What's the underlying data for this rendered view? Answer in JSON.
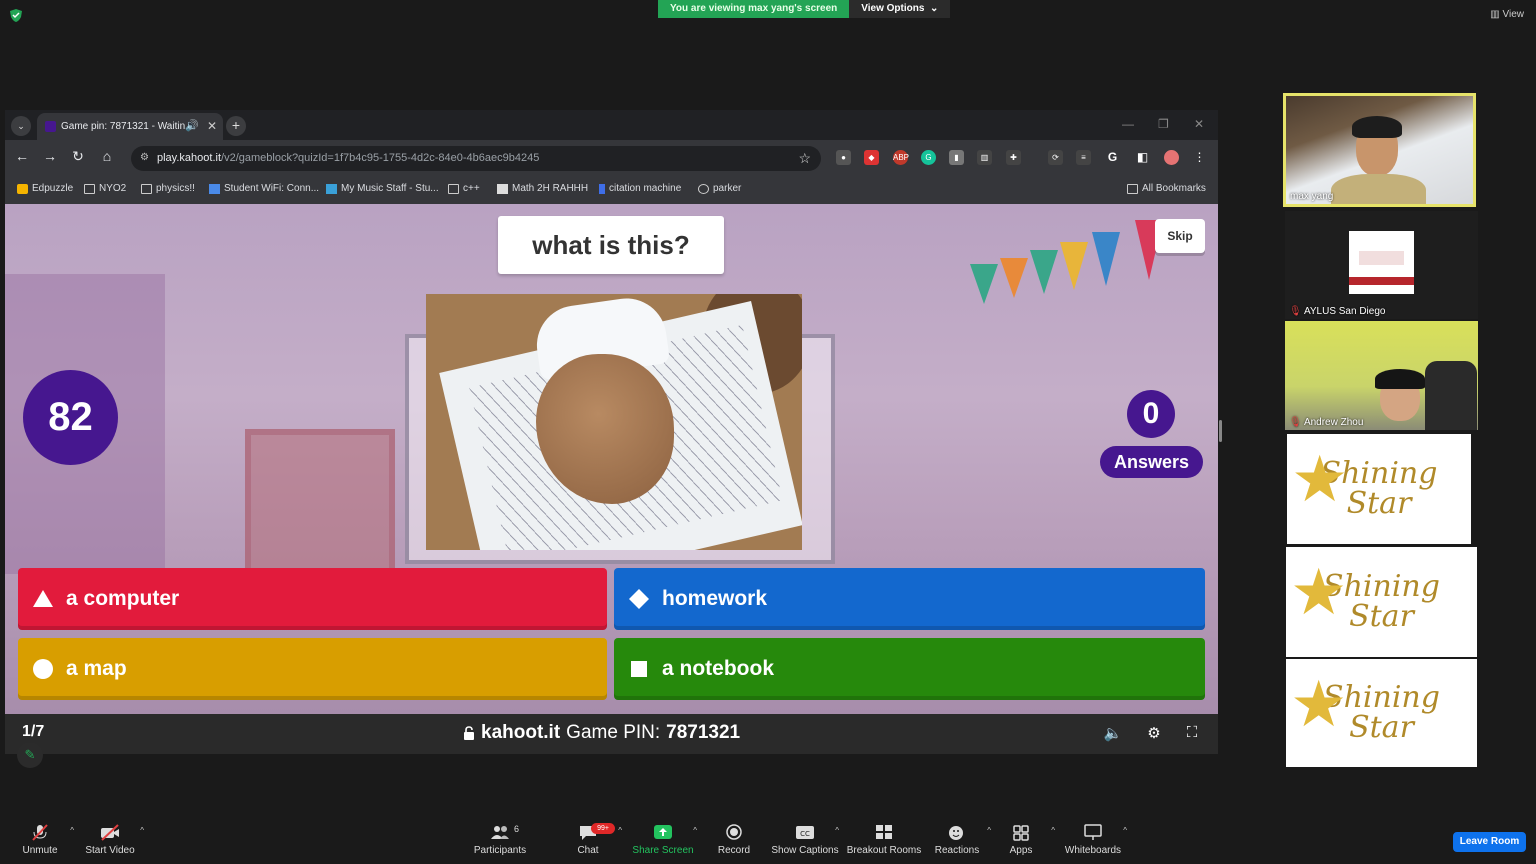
{
  "zoom": {
    "share_banner": "You are viewing max yang's screen",
    "view_options": "View Options",
    "view_label": "View",
    "leave": "Leave Room",
    "toolbar": [
      {
        "id": "unmute",
        "label": "Unmute",
        "icon": "muted-mic-icon"
      },
      {
        "id": "video",
        "label": "Start Video",
        "icon": "video-off-icon"
      },
      {
        "id": "participants",
        "label": "Participants",
        "count": "6",
        "icon": "participants-icon"
      },
      {
        "id": "chat",
        "label": "Chat",
        "badge": "99+",
        "icon": "chat-icon"
      },
      {
        "id": "share",
        "label": "Share Screen",
        "icon": "share-screen-icon"
      },
      {
        "id": "record",
        "label": "Record",
        "icon": "record-icon"
      },
      {
        "id": "captions",
        "label": "Show Captions",
        "icon": "captions-icon"
      },
      {
        "id": "breakout",
        "label": "Breakout Rooms",
        "icon": "breakout-icon"
      },
      {
        "id": "reactions",
        "label": "Reactions",
        "icon": "reactions-icon"
      },
      {
        "id": "apps",
        "label": "Apps",
        "icon": "apps-icon"
      },
      {
        "id": "whiteboards",
        "label": "Whiteboards",
        "icon": "whiteboard-icon"
      }
    ]
  },
  "participants": [
    {
      "name": "max yang"
    },
    {
      "name": "AYLUS San Diego"
    },
    {
      "name": "Andrew Zhou"
    },
    {
      "name": "",
      "card": "Shining Star"
    },
    {
      "name": "",
      "card": "Shining Star"
    },
    {
      "name": "",
      "card": "Shining Star"
    }
  ],
  "browser": {
    "tab_title": "Game pin: 7871321 - Waitin",
    "url_host": "play.kahoot.it",
    "url_path": "/v2/gameblock?quizId=1f7b4c95-1755-4d2c-84e0-4b6aec9b4245",
    "bookmarks": [
      "Edpuzzle",
      "NYO2",
      "physics!!",
      "Student WiFi: Conn...",
      "My Music Staff - Stu...",
      "c++",
      "Math 2H RAHHH",
      "citation machine",
      "parker"
    ],
    "all_bookmarks": "All Bookmarks"
  },
  "kahoot": {
    "question": "what is this?",
    "skip": "Skip",
    "timer": "82",
    "answers_count": "0",
    "answers_label": "Answers",
    "options": [
      {
        "text": "a computer",
        "color": "#e21b3c",
        "shape": "triangle"
      },
      {
        "text": "homework",
        "color": "#1368ce",
        "shape": "diamond"
      },
      {
        "text": "a map",
        "color": "#d89e00",
        "shape": "circle"
      },
      {
        "text": "a notebook",
        "color": "#26890c",
        "shape": "square"
      }
    ],
    "progress": "1/7",
    "site": "kahoot.it",
    "pin_label": "Game PIN:",
    "pin": "7871321"
  }
}
